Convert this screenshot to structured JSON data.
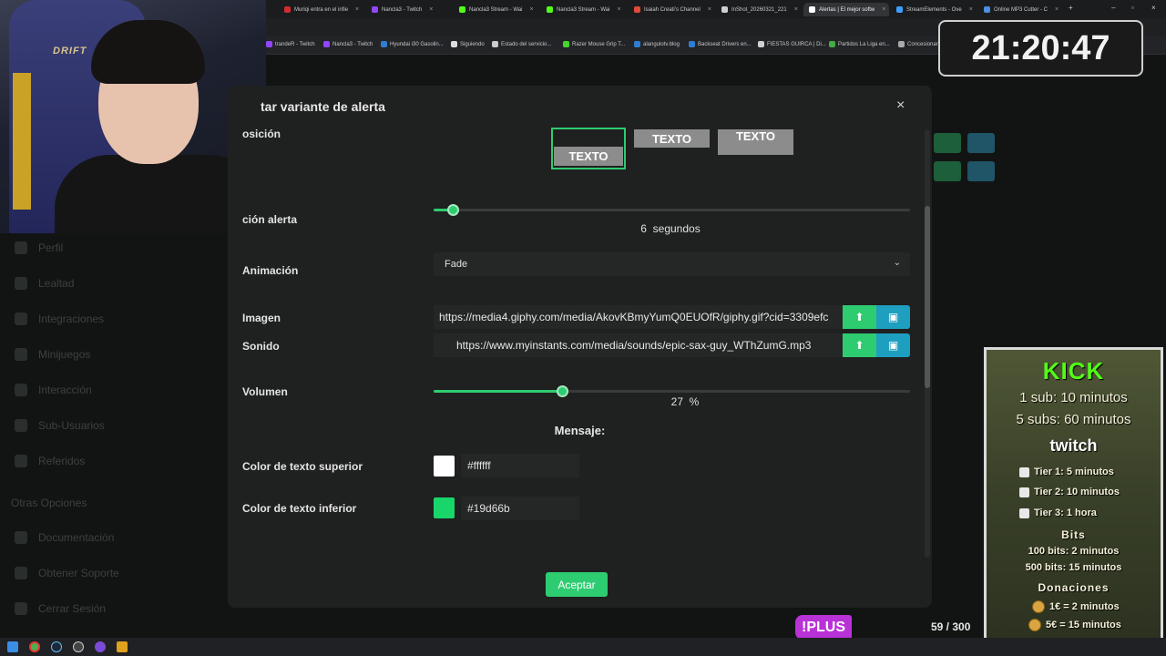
{
  "browser": {
    "tabs": [
      {
        "label": "Muriqi entra en el infie",
        "color": "#d22d2d"
      },
      {
        "label": "Nancla3 - Twitch",
        "color": "#9146ff"
      },
      {
        "label": "Nancla3 Stream - Wai",
        "color": "#53fc18"
      },
      {
        "label": "Nancla3 Stream - Wai",
        "color": "#53fc18"
      },
      {
        "label": "Isaiah Creati's Channel",
        "color": "#e04a3a"
      },
      {
        "label": "InShot_20260321_221",
        "color": "#cfcfcf"
      },
      {
        "label": "Alertas | El mejor softw",
        "color": "#ffffff"
      },
      {
        "label": "StreamElements - Ove",
        "color": "#3aa0ff"
      },
      {
        "label": "Online MP3 Cutter - C",
        "color": "#4a90e2"
      }
    ],
    "bookmarks": [
      {
        "label": "trandeR - Twitch",
        "color": "#9146ff"
      },
      {
        "label": "Nancla3 - Twitch",
        "color": "#9146ff"
      },
      {
        "label": "Hyundai i30 Gasolin...",
        "color": "#2e7dd1"
      },
      {
        "label": "Siguiendo",
        "color": "#dddddd"
      },
      {
        "label": "Estado del servicio...",
        "color": "#cccccc"
      },
      {
        "label": "Razer Mouse Grip T...",
        "color": "#44d62c"
      },
      {
        "label": "alangulotv.blog",
        "color": "#2e7dd1"
      },
      {
        "label": "Backseat Drivers en...",
        "color": "#2e7dd1"
      },
      {
        "label": "FIESTAS GUIRCA | Di...",
        "color": "#d0d0d0"
      },
      {
        "label": "Partidos La Liga en...",
        "color": "#44aa44"
      },
      {
        "label": "Concesionario",
        "color": "#aaaaaa"
      }
    ]
  },
  "background_page": {
    "sidebar": [
      "Perfil",
      "Lealtad",
      "Integraciones",
      "Minijuegos",
      "Interacción",
      "Sub-Usuarios",
      "Referidos"
    ],
    "section_heading": "Otras Opciones",
    "section_items": [
      "Documentación",
      "Obtener Soporte",
      "Cerrar Sesión"
    ]
  },
  "clock": {
    "time": "21:20:47"
  },
  "webcam": {
    "chair_brand": "DRIFT"
  },
  "modal": {
    "title": "tar variante de alerta",
    "close_label": "×",
    "position_label": "osición",
    "position_options": [
      "TEXTO",
      "TEXTO",
      "TEXTO"
    ],
    "duration_label": "ción alerta",
    "duration_value": 6,
    "duration_unit": "segundos",
    "duration_fraction": 0.04,
    "animation_label": "Animación",
    "animation_value": "Fade",
    "image_label": "Imagen",
    "image_url": "https://media4.giphy.com/media/AkovKBmyYumQ0EUOfR/giphy.gif?cid=3309efc",
    "sound_label": "Sonido",
    "sound_url": "https://www.myinstants.com/media/sounds/epic-sax-guy_WThZumG.mp3",
    "volume_label": "Volumen",
    "volume_value": 27,
    "volume_unit": "%",
    "message_heading": "Mensaje:",
    "top_color_label": "Color de texto superior",
    "top_color_value": "#ffffff",
    "bottom_color_label": "Color de texto inferior",
    "bottom_color_value": "#19d66b",
    "accept_label": "Aceptar"
  },
  "overlay": {
    "plus_badge": "!PLUS",
    "counter": "59 / 300"
  },
  "kick_panel": {
    "kick_title": "KICK",
    "kick_lines": [
      "1 sub: 10 minutos",
      "5 subs: 60 minutos"
    ],
    "twitch_title": "twitch",
    "tiers": [
      "Tier 1: 5 minutos",
      "Tier 2: 10 minutos",
      "Tier 3: 1 hora"
    ],
    "bits_title": "Bits",
    "bits_lines": [
      "100 bits: 2 minutos",
      "500 bits: 15 minutos"
    ],
    "donations_title": "Donaciones",
    "donation_lines": [
      "1€ = 2 minutos",
      "5€ = 15 minutos"
    ]
  },
  "colors": {
    "accent_green": "#2ecc71",
    "library_blue": "#1e9fbf",
    "plus_purple": "#b832d6",
    "kick_green": "#53fc18"
  }
}
